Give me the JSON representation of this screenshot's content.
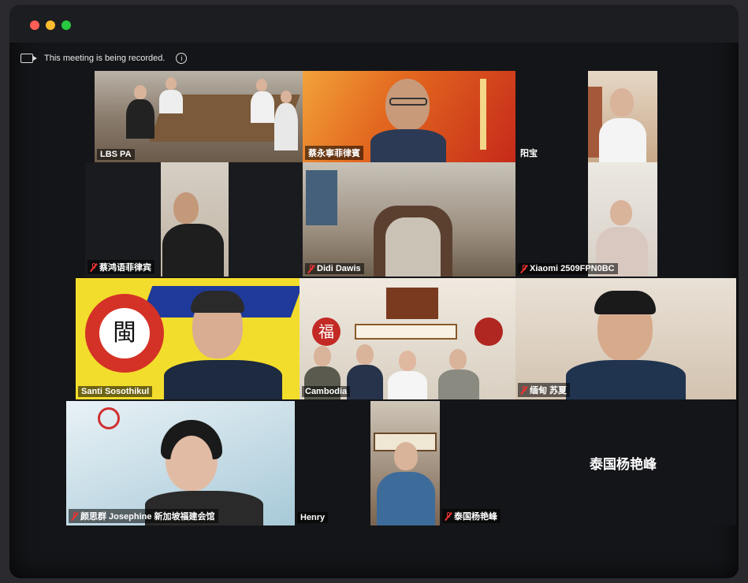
{
  "recording_notice": "This meeting is being recorded.",
  "tiles": {
    "lbs_pa": "LBS PA",
    "cai_yong_ning": "蔡永寧菲律賓",
    "yang_bao": "阳宝",
    "cai_hong_yu": "蔡鸿语菲律宾",
    "didi_dawis": "Didi Dawis",
    "xiaomi": "Xiaomi 2509FPN0BC",
    "santi": "Santi Sosothikul",
    "cambodia": "Cambodia",
    "miandian": "缅甸 苏夏",
    "josephine": "颜思群 Josephine 新加坡福建会馆",
    "henry": "Henry",
    "thailand_label": "泰国杨艳峰",
    "thailand_center": "泰国杨艳峰"
  },
  "logos": {
    "gear_char": "閩",
    "fujian_char": "福"
  },
  "colors": {
    "active_speaker": "#3fcf4a",
    "mute": "#e33333",
    "background": "#141518"
  }
}
